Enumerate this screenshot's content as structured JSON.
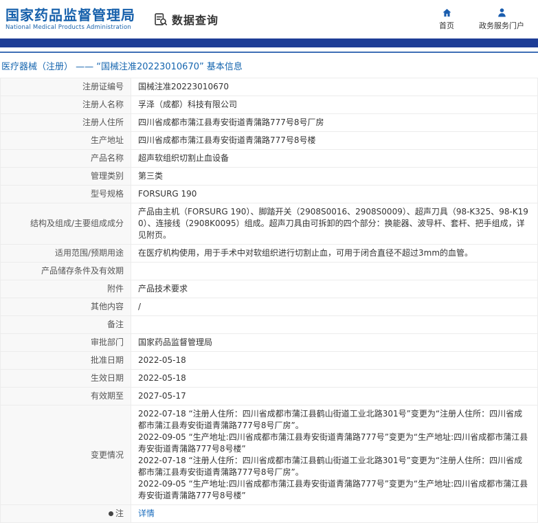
{
  "header": {
    "logo_title": "国家药品监督管理局",
    "logo_subtitle": "National Medical Products Administration",
    "section_title": "数据查询",
    "nav": [
      {
        "icon": "home-icon",
        "label": "首页"
      },
      {
        "icon": "user-icon",
        "label": "政务服务门户"
      }
    ]
  },
  "colors": {
    "brand_blue": "#1660ab",
    "navbar_blue": "#1e3d96",
    "link_blue": "#1b6dbd"
  },
  "breadcrumb": {
    "text": "医疗器械（注册） —— “国械注准20223010670” 基本信息"
  },
  "table": {
    "rows": [
      {
        "label": "注册证编号",
        "value": "国械注准20223010670"
      },
      {
        "label": "注册人名称",
        "value": "孚泽（成都）科技有限公司"
      },
      {
        "label": "注册人住所",
        "value": "四川省成都市蒲江县寿安街道青蒲路777号8号厂房"
      },
      {
        "label": "生产地址",
        "value": "四川省成都市蒲江县寿安街道青蒲路777号8号楼"
      },
      {
        "label": "产品名称",
        "value": "超声软组织切割止血设备"
      },
      {
        "label": "管理类别",
        "value": "第三类"
      },
      {
        "label": "型号规格",
        "value": "FORSURG 190"
      },
      {
        "label": "结构及组成/主要组成成分",
        "value": "产品由主机（FORSURG 190）、脚踏开关（2908S0016、2908S0009）、超声刀具（98-K325、98-K190）、连接线（2908K0095）组成。超声刀具由可拆卸的四个部分：换能器、波导杆、套杆、把手组成，详见附页。"
      },
      {
        "label": "适用范围/预期用途",
        "value": "在医疗机构使用，用于手术中对软组织进行切割止血，可用于闭合直径不超过3mm的血管。"
      },
      {
        "label": "产品储存条件及有效期",
        "value": ""
      },
      {
        "label": "附件",
        "value": "产品技术要求"
      },
      {
        "label": "其他内容",
        "value": "/"
      },
      {
        "label": "备注",
        "value": ""
      },
      {
        "label": "审批部门",
        "value": "国家药品监督管理局"
      },
      {
        "label": "批准日期",
        "value": "2022-05-18"
      },
      {
        "label": "生效日期",
        "value": "2022-05-18"
      },
      {
        "label": "有效期至",
        "value": "2027-05-17"
      },
      {
        "label": "变更情况",
        "value": "2022-07-18 “注册人住所：四川省成都市蒲江县鹤山街道工业北路301号”变更为“注册人住所：四川省成都市蒲江县寿安街道青蒲路777号8号厂房”。\n2022-09-05 “生产地址:四川省成都市蒲江县寿安街道青蒲路777号”变更为“生产地址:四川省成都市蒲江县寿安街道青蒲路777号8号楼”\n2022-07-18 “注册人住所：四川省成都市蒲江县鹤山街道工业北路301号”变更为“注册人住所：四川省成都市蒲江县寿安街道青蒲路777号8号厂房”。\n2022-09-05 “生产地址:四川省成都市蒲江县寿安街道青蒲路777号”变更为“生产地址:四川省成都市蒲江县寿安街道青蒲路777号8号楼”"
      },
      {
        "label": "注",
        "value": "详情"
      }
    ]
  }
}
